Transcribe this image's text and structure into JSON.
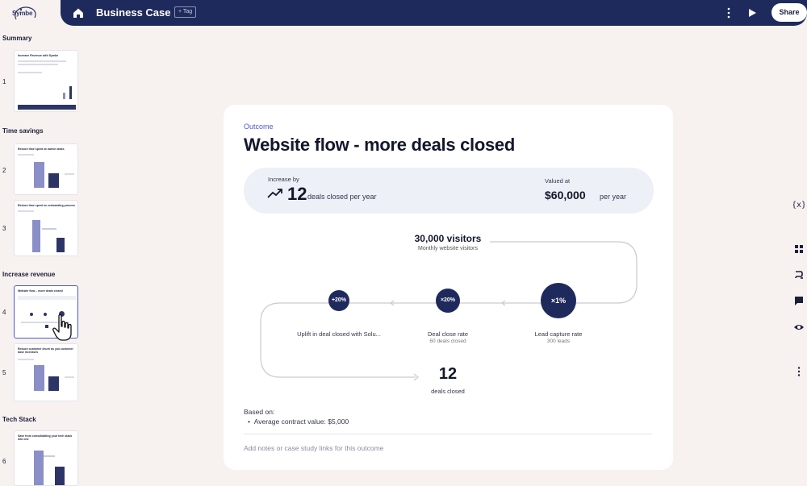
{
  "app": {
    "logo_text": "Symbe"
  },
  "header": {
    "title": "Business Case",
    "tag_label": "+ Tag",
    "share_label": "Share"
  },
  "sidebar": {
    "sections": [
      {
        "label": "Summary",
        "slides": [
          {
            "number": "1",
            "title": "Increase Revenue with Symbe"
          }
        ]
      },
      {
        "label": "Time savings",
        "slides": [
          {
            "number": "2",
            "title": "Reduce time spent on admin tasks"
          },
          {
            "number": "3",
            "title": "Reduce time spent on onboarding process"
          }
        ]
      },
      {
        "label": "Increase revenue",
        "slides": [
          {
            "number": "4",
            "title": "Website flow – more deals closed"
          },
          {
            "number": "5",
            "title": "Reduce customer churn as you customer base increases"
          }
        ]
      },
      {
        "label": "Tech Stack",
        "slides": [
          {
            "number": "6",
            "title": "Save from consolidating your tech stack into one"
          }
        ]
      }
    ]
  },
  "card": {
    "eyebrow": "Outcome",
    "title": "Website flow - more deals closed",
    "increase_label": "Increase by",
    "increase_value": "12",
    "increase_unit": "deals closed per year",
    "valued_label": "Valued at",
    "valued_amount": "$60,000",
    "valued_unit": "per year",
    "flow": {
      "source_value": "30,000 visitors",
      "source_sub": "Monthly website visitors",
      "nodes": [
        {
          "value": "×1%",
          "label": "Lead capture rate",
          "sub": "300 leads"
        },
        {
          "value": "×20%",
          "label": "Deal close rate",
          "sub": "60 deals closed"
        },
        {
          "value": "+20%",
          "label": "Uplift in deal closed with Solu...",
          "sub": ""
        }
      ],
      "result_value": "12",
      "result_sub": "deals closed"
    },
    "based_on_label": "Based on:",
    "based_on_items": [
      "Average contract value: $5,000"
    ],
    "notes_placeholder": "Add notes or case study links for this outcome"
  }
}
